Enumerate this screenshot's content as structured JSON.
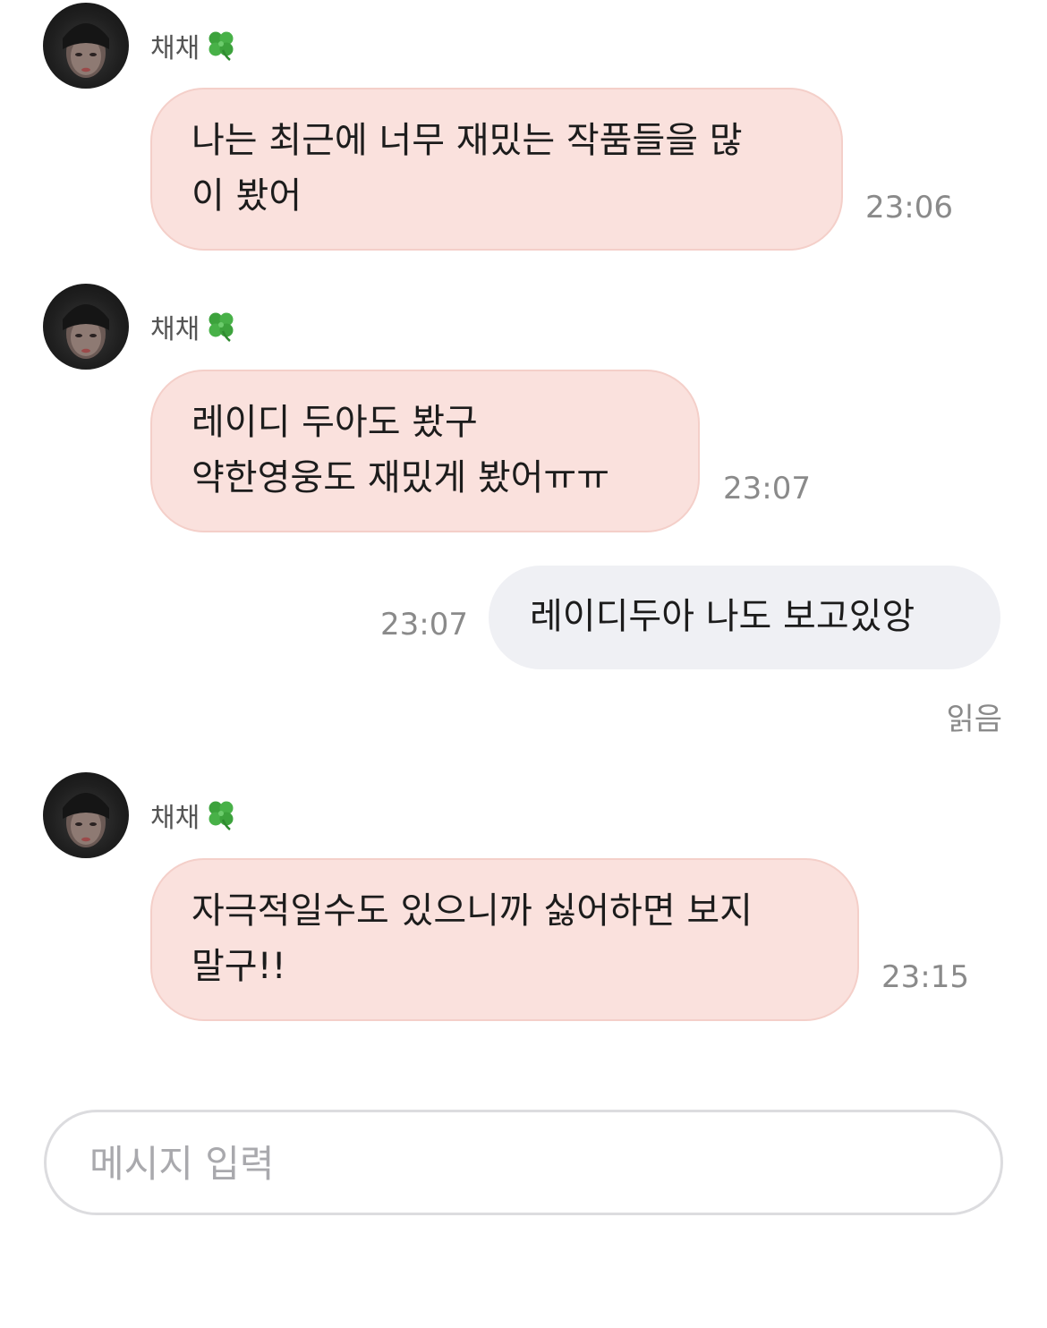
{
  "messages": [
    {
      "sender": "채채",
      "text": "나는 최근에 너무 재밌는 작품들을 많\n이 봤어",
      "time": "23:06"
    },
    {
      "sender": "채채",
      "text": "레이디 두아도 봤구\n약한영웅도 재밌게 봤어ㅠㅠ",
      "time": "23:07"
    },
    {
      "sender": "me",
      "text": "레이디두아 나도 보고있앙",
      "time": "23:07",
      "status": "읽음"
    },
    {
      "sender": "채채",
      "text": "자극적일수도 있으니까 싫어하면 보지\n말구!!",
      "time": "23:15"
    }
  ],
  "composer": {
    "placeholder": "메시지 입력"
  },
  "colors": {
    "incoming_bubble": "#fae1dd",
    "outgoing_bubble": "#eff0f4",
    "timestamp": "#8a8a8a"
  },
  "icons": {
    "sender_badge": "four-leaf-clover-icon"
  }
}
